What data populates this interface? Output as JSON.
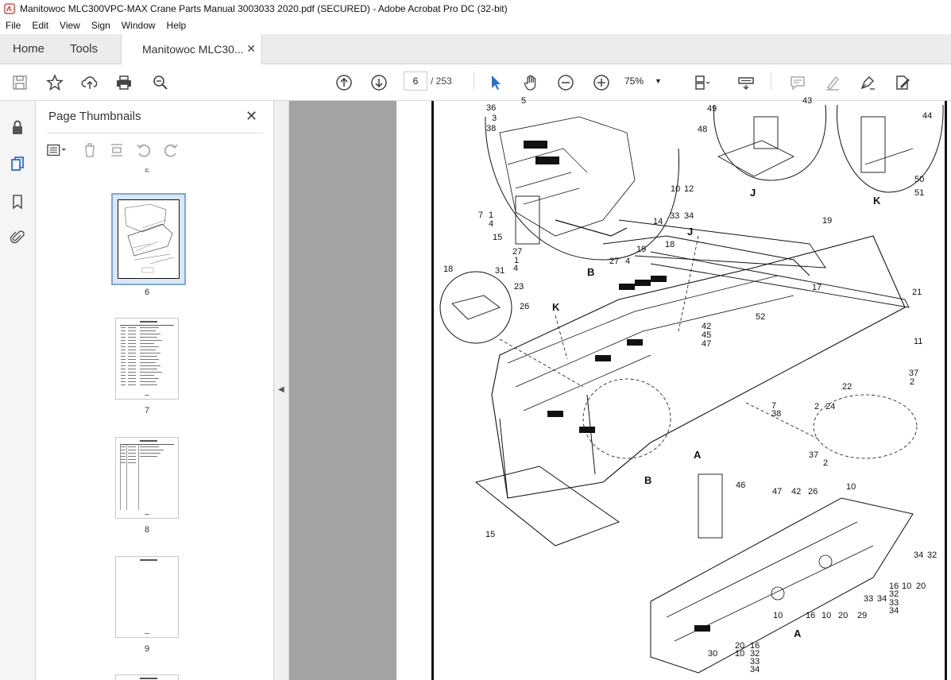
{
  "window": {
    "title": "Manitowoc MLC300VPC-MAX Crane Parts Manual 3003033 2020.pdf (SECURED) - Adobe Acrobat Pro DC (32-bit)"
  },
  "menu": [
    "File",
    "Edit",
    "View",
    "Sign",
    "Window",
    "Help"
  ],
  "tabs": {
    "home": "Home",
    "tools": "Tools",
    "document": "Manitowoc MLC30...",
    "close": "✕"
  },
  "toolbar": {
    "current_page": "6",
    "page_total": "/ 253",
    "zoom": "75%"
  },
  "thumbnail_panel": {
    "title": "Page Thumbnails",
    "close": "✕",
    "thumbnails": [
      {
        "label": "6",
        "selected": true
      },
      {
        "label": "7",
        "selected": false
      },
      {
        "label": "8",
        "selected": false
      },
      {
        "label": "9",
        "selected": false
      }
    ],
    "partial_top_label": "5"
  },
  "drawing_callouts": [
    "36",
    "3",
    "38",
    "5",
    "49",
    "48",
    "43",
    "44",
    "J",
    "K",
    "50",
    "51",
    "10",
    "12",
    "7",
    "1",
    "4",
    "33",
    "34",
    "14",
    "15",
    "19",
    "27",
    "1",
    "4",
    "27",
    "4",
    "B",
    "18",
    "31",
    "23",
    "J",
    "19",
    "18",
    "17",
    "K",
    "26",
    "52",
    "21",
    "42",
    "45",
    "47",
    "11",
    "22",
    "37",
    "2",
    "7",
    "38",
    "2",
    "24",
    "37",
    "2",
    "A",
    "B",
    "15",
    "46",
    "47",
    "42",
    "26",
    "10",
    "34",
    "32",
    "16",
    "32",
    "33",
    "34",
    "10",
    "20",
    "33",
    "34",
    "10",
    "16",
    "10",
    "20",
    "29",
    "A",
    "30",
    "20",
    "10",
    "16",
    "32",
    "33",
    "34"
  ],
  "colors": {
    "accent_blue": "#2c6fd1",
    "acrobat_red": "#d7261e",
    "page_gray": "#a3a3a3"
  }
}
